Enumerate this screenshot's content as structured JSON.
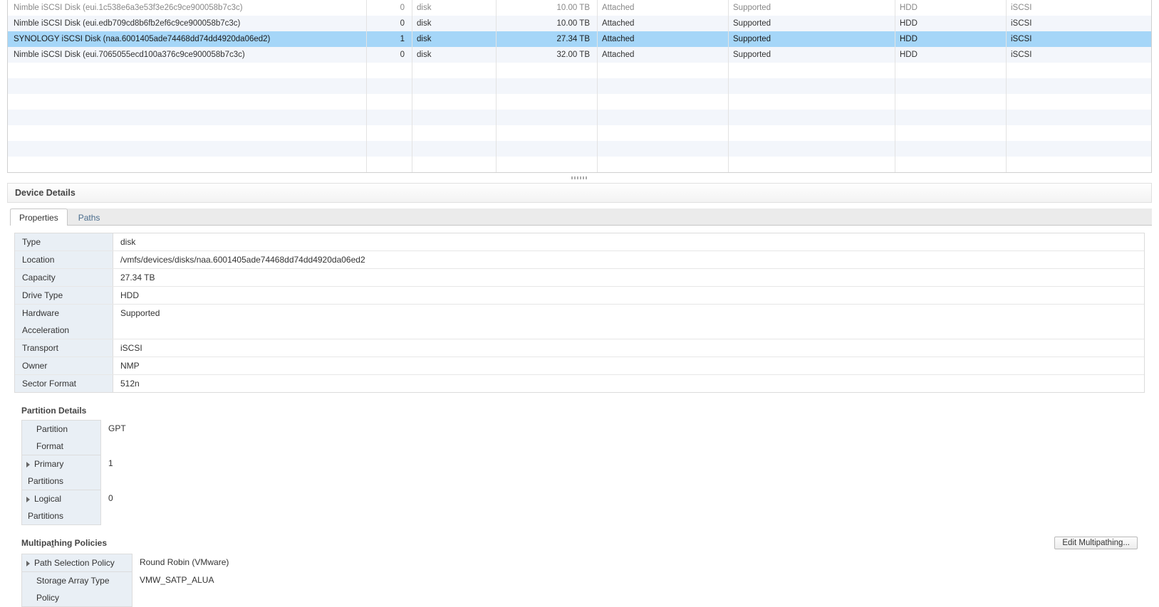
{
  "grid": {
    "rows": [
      {
        "name": "Nimble iSCSI Disk (eui.1c538e6a3e53f3e26c9ce900058b7c3c)",
        "lun": "0",
        "type": "disk",
        "capacity": "10.00 TB",
        "status": "Attached",
        "hw": "Supported",
        "drive": "HDD",
        "transport": "iSCSI",
        "selected": false,
        "faded": true
      },
      {
        "name": "Nimble iSCSI Disk (eui.edb709cd8b6fb2ef6c9ce900058b7c3c)",
        "lun": "0",
        "type": "disk",
        "capacity": "10.00 TB",
        "status": "Attached",
        "hw": "Supported",
        "drive": "HDD",
        "transport": "iSCSI",
        "selected": false,
        "faded": false
      },
      {
        "name": "SYNOLOGY iSCSI Disk (naa.6001405ade74468dd74dd4920da06ed2)",
        "lun": "1",
        "type": "disk",
        "capacity": "27.34 TB",
        "status": "Attached",
        "hw": "Supported",
        "drive": "HDD",
        "transport": "iSCSI",
        "selected": true,
        "faded": false
      },
      {
        "name": "Nimble iSCSI Disk (eui.7065055ecd100a376c9ce900058b7c3c)",
        "lun": "0",
        "type": "disk",
        "capacity": "32.00 TB",
        "status": "Attached",
        "hw": "Supported",
        "drive": "HDD",
        "transport": "iSCSI",
        "selected": false,
        "faded": false
      }
    ],
    "blankRows": 7
  },
  "details": {
    "title": "Device Details",
    "tabs": {
      "properties": "Properties",
      "paths": "Paths"
    },
    "props": [
      {
        "label": "Type",
        "value": "disk"
      },
      {
        "label": "Location",
        "value": "/vmfs/devices/disks/naa.6001405ade74468dd74dd4920da06ed2"
      },
      {
        "label": "Capacity",
        "value": "27.34 TB"
      },
      {
        "label": "Drive Type",
        "value": "HDD"
      },
      {
        "label": "Hardware Acceleration",
        "value": "Supported"
      },
      {
        "label": "Transport",
        "value": "iSCSI"
      },
      {
        "label": "Owner",
        "value": "NMP"
      },
      {
        "label": "Sector Format",
        "value": "512n"
      }
    ],
    "partition": {
      "title": "Partition Details",
      "rows": [
        {
          "label": "Partition Format",
          "value": "GPT",
          "expandable": false
        },
        {
          "label": "Primary Partitions",
          "value": "1",
          "expandable": true
        },
        {
          "label": "Logical Partitions",
          "value": "0",
          "expandable": true
        }
      ]
    },
    "multipath": {
      "title_prefix": "Multipa",
      "title_underline": "t",
      "title_suffix": "hing Policies",
      "button": "Edit Multipathing...",
      "rows": [
        {
          "label": "Path Selection Policy",
          "value": "Round Robin (VMware)",
          "expandable": true,
          "cutoff": false
        },
        {
          "label": "Storage Array Type Policy",
          "value": "VMW_SATP_ALUA",
          "expandable": false,
          "cutoff": true
        }
      ]
    }
  }
}
